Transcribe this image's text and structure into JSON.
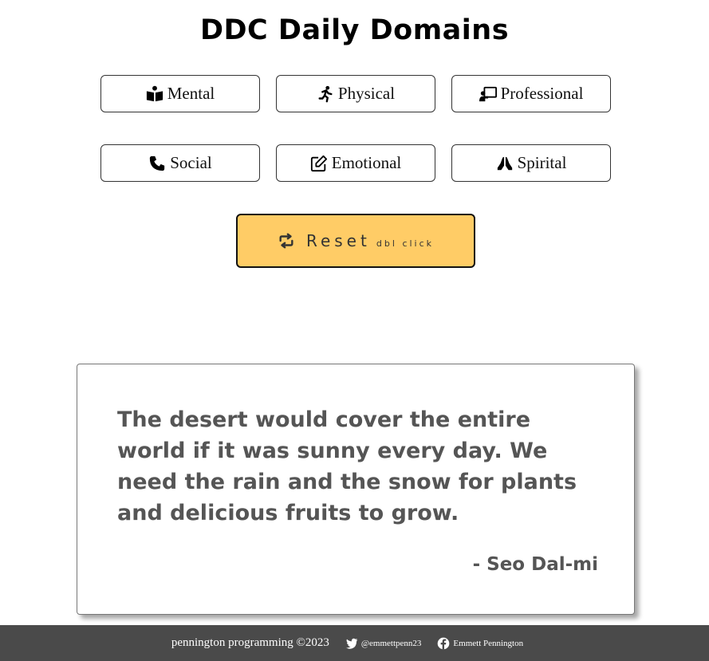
{
  "header": {
    "title": "DDC Daily Domains"
  },
  "domains": [
    {
      "label": "Mental",
      "icon": "book-reader-icon"
    },
    {
      "label": "Physical",
      "icon": "running-icon"
    },
    {
      "label": "Professional",
      "icon": "chalkboard-teacher-icon"
    },
    {
      "label": "Social",
      "icon": "phone-icon"
    },
    {
      "label": "Emotional",
      "icon": "edit-icon"
    },
    {
      "label": "Spirital",
      "icon": "praying-hands-icon"
    }
  ],
  "reset": {
    "label": "Reset",
    "hint": "dbl click",
    "icon": "retweet-icon",
    "color": "#ffcc66"
  },
  "quote": {
    "text": "The desert would cover the entire world if it was sunny every day. We need the rain and the snow for plants and delicious fruits to grow.",
    "author": "- Seo Dal-mi"
  },
  "footer": {
    "copyright": "pennington programming ©2023",
    "twitter": {
      "handle": "@emmettpenn23",
      "icon": "twitter-icon"
    },
    "facebook": {
      "name": "Emmett Pennington",
      "icon": "facebook-icon"
    },
    "background": "#4a4a4a"
  }
}
